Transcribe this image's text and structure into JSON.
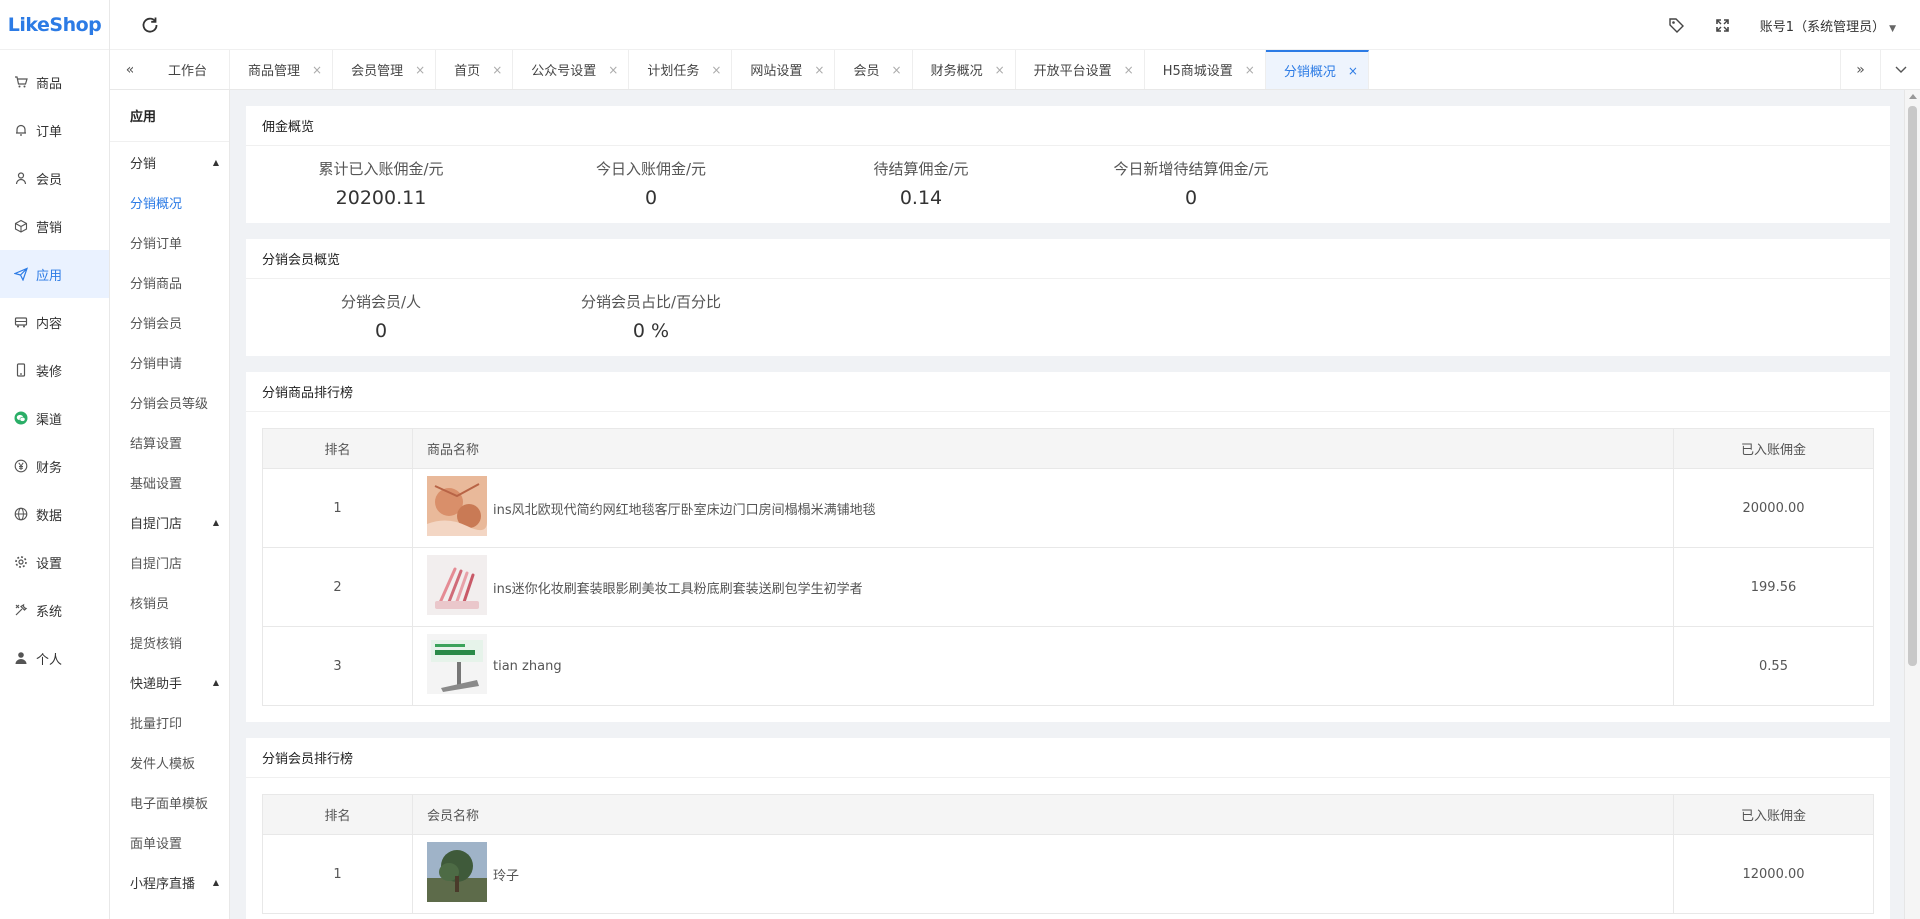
{
  "brand": {
    "logo_text": "LikeShop",
    "accent": "#2c7be5"
  },
  "nav": {
    "items": [
      {
        "label": "商品",
        "icon": "cart-icon"
      },
      {
        "label": "订单",
        "icon": "bell-icon"
      },
      {
        "label": "会员",
        "icon": "user-icon"
      },
      {
        "label": "营销",
        "icon": "box-icon"
      },
      {
        "label": "应用",
        "icon": "send-icon",
        "active": true
      },
      {
        "label": "内容",
        "icon": "bus-icon"
      },
      {
        "label": "装修",
        "icon": "phone-icon"
      },
      {
        "label": "渠道",
        "icon": "wechat-icon"
      },
      {
        "label": "财务",
        "icon": "yen-icon"
      },
      {
        "label": "数据",
        "icon": "globe-icon"
      },
      {
        "label": "设置",
        "icon": "gear-icon"
      },
      {
        "label": "系统",
        "icon": "tools-icon"
      },
      {
        "label": "个人",
        "icon": "person-icon"
      }
    ]
  },
  "header": {
    "account": "账号1（系统管理员）"
  },
  "tabs": [
    {
      "label": "工作台"
    },
    {
      "label": "商品管理"
    },
    {
      "label": "会员管理"
    },
    {
      "label": "首页"
    },
    {
      "label": "公众号设置"
    },
    {
      "label": "计划任务"
    },
    {
      "label": "网站设置"
    },
    {
      "label": "会员"
    },
    {
      "label": "财务概况"
    },
    {
      "label": "开放平台设置"
    },
    {
      "label": "H5商城设置"
    },
    {
      "label": "分销概况",
      "active": true
    }
  ],
  "submenu": {
    "title": "应用",
    "groups": [
      {
        "label": "分销",
        "items": [
          "分销概况",
          "分销订单",
          "分销商品",
          "分销会员",
          "分销申请",
          "分销会员等级",
          "结算设置",
          "基础设置"
        ]
      },
      {
        "label": "自提门店",
        "items": [
          "自提门店",
          "核销员",
          "提货核销"
        ]
      },
      {
        "label": "快递助手",
        "items": [
          "批量打印",
          "发件人模板",
          "电子面单模板",
          "面单设置"
        ]
      },
      {
        "label": "小程序直播",
        "items": []
      }
    ]
  },
  "commission": {
    "title": "佣金概览",
    "stats": [
      {
        "label": "累计已入账佣金/元",
        "value": "20200.11"
      },
      {
        "label": "今日入账佣金/元",
        "value": "0"
      },
      {
        "label": "待结算佣金/元",
        "value": "0.14"
      },
      {
        "label": "今日新增待结算佣金/元",
        "value": "0"
      }
    ]
  },
  "members_overview": {
    "title": "分销会员概览",
    "stats": [
      {
        "label": "分销会员/人",
        "value": "0"
      },
      {
        "label": "分销会员占比/百分比",
        "value": "0 %"
      }
    ]
  },
  "goods_rank": {
    "title": "分销商品排行榜",
    "headers": {
      "rank": "排名",
      "name": "商品名称",
      "amount": "已入账佣金"
    },
    "rows": [
      {
        "rank": "1",
        "name": "ins风北欧现代简约网红地毯客厅卧室床边门口房间榻榻米满铺地毯",
        "amount": "20000.00"
      },
      {
        "rank": "2",
        "name": "ins迷你化妆刷套装眼影刷美妆工具粉底刷套装送刷包学生初学者",
        "amount": "199.56"
      },
      {
        "rank": "3",
        "name": "tian zhang",
        "amount": "0.55"
      }
    ]
  },
  "member_rank": {
    "title": "分销会员排行榜",
    "headers": {
      "rank": "排名",
      "name": "会员名称",
      "amount": "已入账佣金"
    },
    "rows": [
      {
        "rank": "1",
        "name": "玲子",
        "amount": "12000.00"
      }
    ]
  }
}
